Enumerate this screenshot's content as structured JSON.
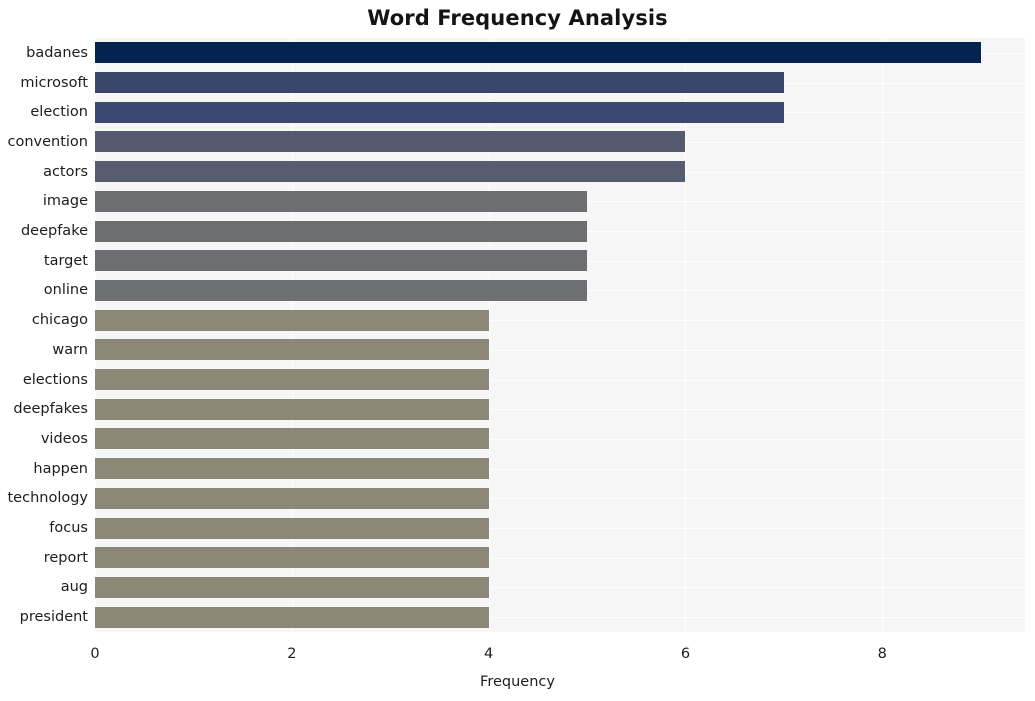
{
  "chart_data": {
    "type": "bar",
    "orientation": "horizontal",
    "title": "Word Frequency Analysis",
    "xlabel": "Frequency",
    "ylabel": "",
    "categories": [
      "badanes",
      "microsoft",
      "election",
      "convention",
      "actors",
      "image",
      "deepfake",
      "target",
      "online",
      "chicago",
      "warn",
      "elections",
      "deepfakes",
      "videos",
      "happen",
      "technology",
      "focus",
      "report",
      "aug",
      "president"
    ],
    "values": [
      9,
      7,
      7,
      6,
      6,
      5,
      5,
      5,
      5,
      4,
      4,
      4,
      4,
      4,
      4,
      4,
      4,
      4,
      4,
      4
    ],
    "xticks": [
      0,
      2,
      4,
      6,
      8
    ],
    "xlim": [
      0,
      9.45
    ],
    "grid": true,
    "legend": null,
    "bar_colors": [
      "#04234f",
      "#3a476b",
      "#3d4870",
      "#555a6e",
      "#585c70",
      "#6d6e72",
      "#6d6e72",
      "#6d6e72",
      "#6e6f73",
      "#8c8878",
      "#8c8878",
      "#8c8878",
      "#8c8878",
      "#8c8878",
      "#8c8878",
      "#8c8878",
      "#8c8878",
      "#8c8878",
      "#8c8878",
      "#8c8878"
    ],
    "plot_background": "#f6f6f7",
    "figure_background": "#ffffff",
    "gridline_color": "#ffffff"
  }
}
